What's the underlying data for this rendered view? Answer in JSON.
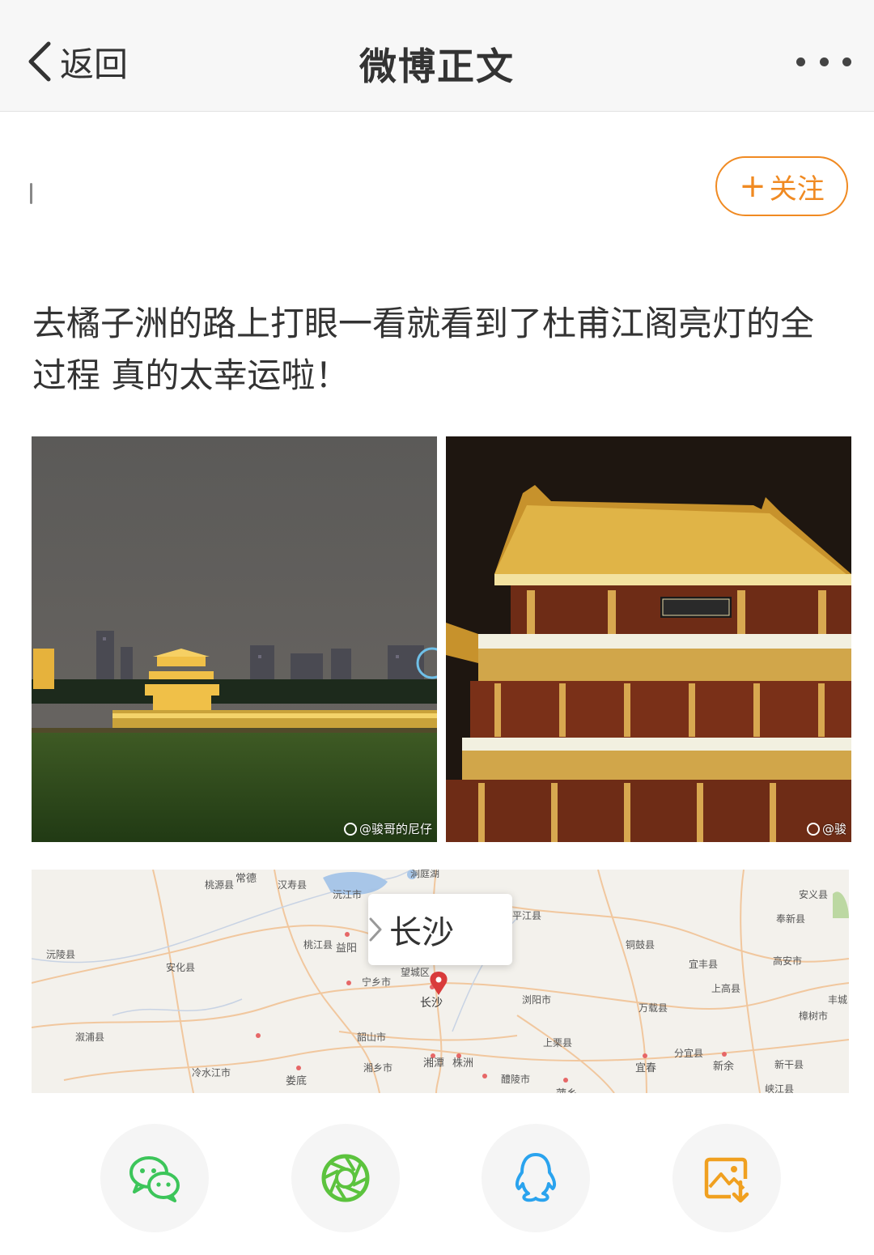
{
  "header": {
    "back_label": "返回",
    "title": "微博正文"
  },
  "profile": {
    "follow_label": "关注",
    "follow_color": "#f08a22"
  },
  "post": {
    "text": "去橘子洲的路上打眼一看就看到了杜甫江阁亮灯的全过程 真的太幸运啦！",
    "images": [
      {
        "alt": "riverside-night-skyline",
        "watermark": "@骏哥的尼仔"
      },
      {
        "alt": "lit-pavilion-closeup",
        "watermark": "@骏"
      }
    ]
  },
  "map": {
    "popup_city": "长沙",
    "labels": {
      "changde": "常德",
      "hanshou": "汉寿县",
      "taoyuan": "桃源县",
      "dongting": "洞庭湖",
      "yuanjiang": "沅江市",
      "anyi": "安义县",
      "fengxin": "奉新县",
      "pingjiang": "平江县",
      "yuanling": "沅陵县",
      "anhua": "安化县",
      "taojiang": "桃江县",
      "yiyang": "益阳",
      "tonggu": "铜鼓县",
      "yifeng": "宜丰县",
      "gaoan": "高安市",
      "wangcheng": "望城区",
      "ningxiang": "宁乡市",
      "changsha": "长沙",
      "liuyang": "浏阳市",
      "wanzai": "万载县",
      "shanggao": "上高县",
      "zhangshu": "樟树市",
      "shaoshan": "韶山市",
      "shangli": "上栗县",
      "lengshuijiang": "冷水江市",
      "loudi": "娄底",
      "xiangxiang": "湘乡市",
      "xiangtan": "湘潭",
      "zhuzhou": "株洲",
      "liling": "醴陵市",
      "pingxiang": "萍乡",
      "yichun": "宜春",
      "fenyi": "分宜县",
      "xinyu": "新余",
      "xingan": "新干县",
      "xiajiang": "峡江县",
      "xupu": "溆浦县",
      "fengcheng": "丰城"
    }
  },
  "share": {
    "items": [
      {
        "name": "wechat",
        "color": "#3cc55a"
      },
      {
        "name": "moments",
        "color": "#5cc33e"
      },
      {
        "name": "qq",
        "color": "#2aa3ee"
      },
      {
        "name": "save-image",
        "color": "#f0a020"
      }
    ]
  }
}
